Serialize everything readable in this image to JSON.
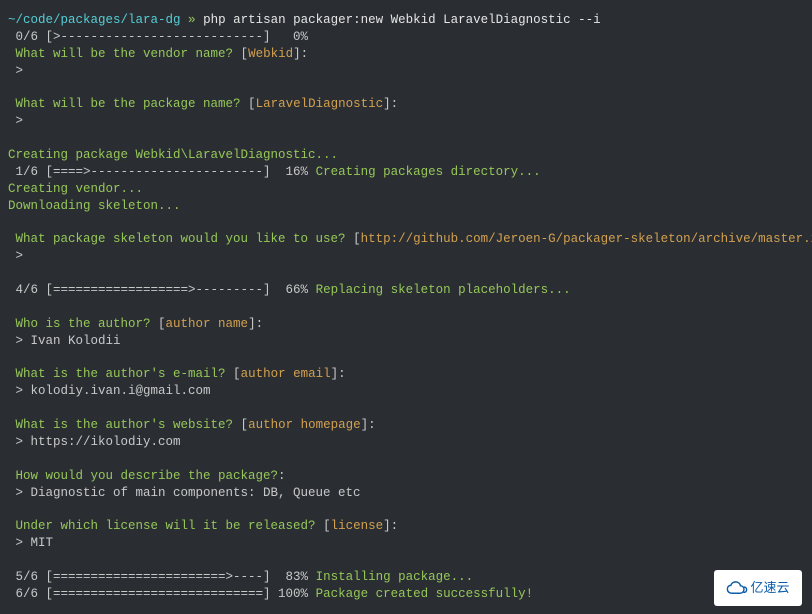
{
  "prompt": {
    "path": "~/code/packages/lara-dg",
    "sep": "»",
    "command": "php artisan packager:new Webkid LaravelDiagnostic --i"
  },
  "progress": {
    "p0": "0/6 [>---------------------------]   0%",
    "p1_bar": "1/6 [====>-----------------------]  16% ",
    "p1_msg": "Creating packages directory...",
    "p4_bar": "4/6 [==================>---------]  66% ",
    "p4_msg": "Replacing skeleton placeholders...",
    "p5_bar": "5/6 [=======================>----]  83% ",
    "p5_msg": "Installing package...",
    "p6_bar": "6/6 [============================] 100% ",
    "p6_msg": "Package created successfully!"
  },
  "q": {
    "vendor": " What will be the vendor name? ",
    "vendor_default": "Webkid",
    "package": " What will be the package name? ",
    "package_default": "LaravelDiagnostic",
    "skeleton": " What package skeleton would you like to use? ",
    "skeleton_default": "http://github.com/Jeroen-G/packager-skeleton/archive/master.zip",
    "author": " Who is the author? ",
    "author_default": "author name",
    "email": " What is the author's e-mail? ",
    "email_default": "author email",
    "website": " What is the author's website? ",
    "website_default": "author homepage",
    "describe": " How would you describe the package?",
    "license": " Under which license will it be released? ",
    "license_default": "license"
  },
  "answers": {
    "author": " > Ivan Kolodii",
    "email": " > kolodiy.ivan.i@gmail.com",
    "website": " > https://ikolodiy.com",
    "describe": " > Diagnostic of main components: DB, Queue etc",
    "license": " > MIT",
    "blank1": " >",
    "blank2": " >",
    "blank3": " >"
  },
  "status": {
    "creating_pkg": "Creating package Webkid\\LaravelDiagnostic...",
    "creating_vendor": "Creating vendor...",
    "downloading": "Downloading skeleton..."
  },
  "punct": {
    "lb": "[",
    "rb_colon": "]:",
    "colon": ":"
  },
  "logo": {
    "text": "亿速云"
  }
}
